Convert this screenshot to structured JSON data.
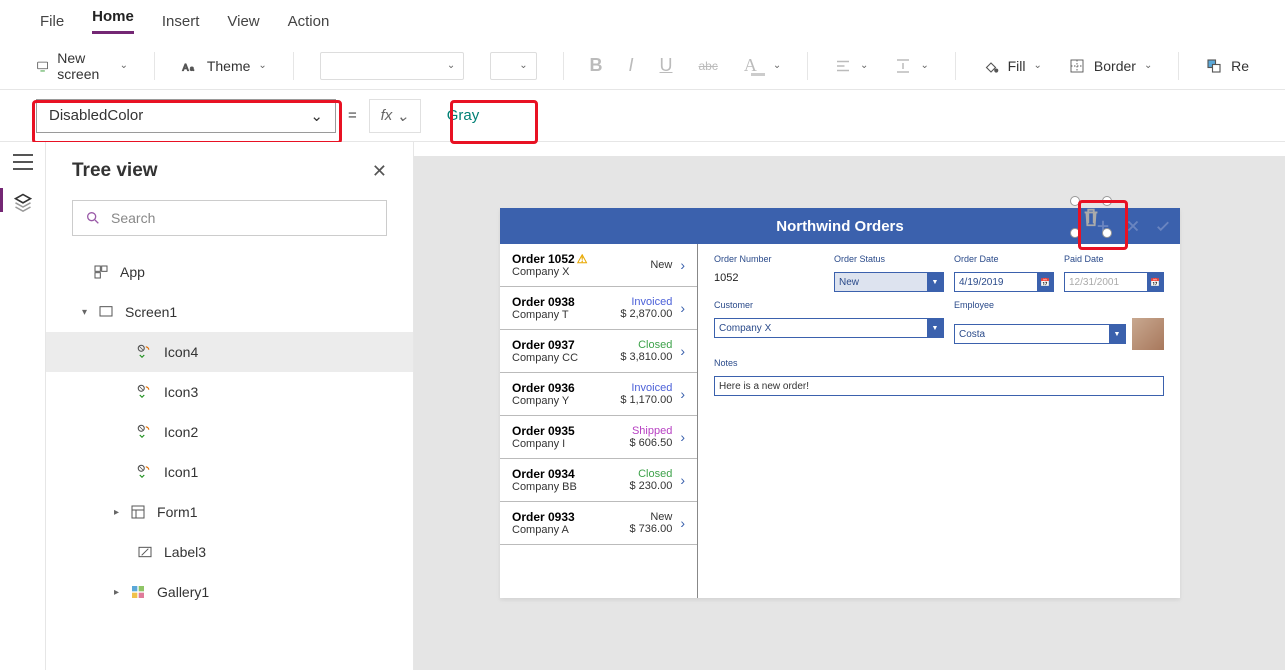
{
  "menu": {
    "file": "File",
    "home": "Home",
    "insert": "Insert",
    "view": "View",
    "action": "Action"
  },
  "ribbon": {
    "new_screen": "New screen",
    "theme": "Theme",
    "fill": "Fill",
    "border": "Border",
    "re": "Re"
  },
  "formula": {
    "property": "DisabledColor",
    "value": "Gray",
    "eq": "=",
    "fx": "fx"
  },
  "tree": {
    "title": "Tree view",
    "search_ph": "Search",
    "app": "App",
    "screen1": "Screen1",
    "icon4": "Icon4",
    "icon3": "Icon3",
    "icon2": "Icon2",
    "icon1": "Icon1",
    "form1": "Form1",
    "label3": "Label3",
    "gallery1": "Gallery1"
  },
  "app": {
    "title": "Northwind Orders",
    "orders": [
      {
        "num": "Order 1052",
        "company": "Company X",
        "status": "New",
        "amount": "",
        "warn": true
      },
      {
        "num": "Order 0938",
        "company": "Company T",
        "status": "Invoiced",
        "amount": "$ 2,870.00"
      },
      {
        "num": "Order 0937",
        "company": "Company CC",
        "status": "Closed",
        "amount": "$ 3,810.00"
      },
      {
        "num": "Order 0936",
        "company": "Company Y",
        "status": "Invoiced",
        "amount": "$ 1,170.00"
      },
      {
        "num": "Order 0935",
        "company": "Company I",
        "status": "Shipped",
        "amount": "$ 606.50"
      },
      {
        "num": "Order 0934",
        "company": "Company BB",
        "status": "Closed",
        "amount": "$ 230.00"
      },
      {
        "num": "Order 0933",
        "company": "Company A",
        "status": "New",
        "amount": "$ 736.00"
      }
    ],
    "detail": {
      "lbl_order_number": "Order Number",
      "order_number": "1052",
      "lbl_order_status": "Order Status",
      "order_status": "New",
      "lbl_order_date": "Order Date",
      "order_date": "4/19/2019",
      "lbl_paid_date": "Paid Date",
      "paid_date": "12/31/2001",
      "lbl_customer": "Customer",
      "customer": "Company X",
      "lbl_employee": "Employee",
      "employee": "Costa",
      "lbl_notes": "Notes",
      "notes": "Here is a new order!"
    }
  }
}
